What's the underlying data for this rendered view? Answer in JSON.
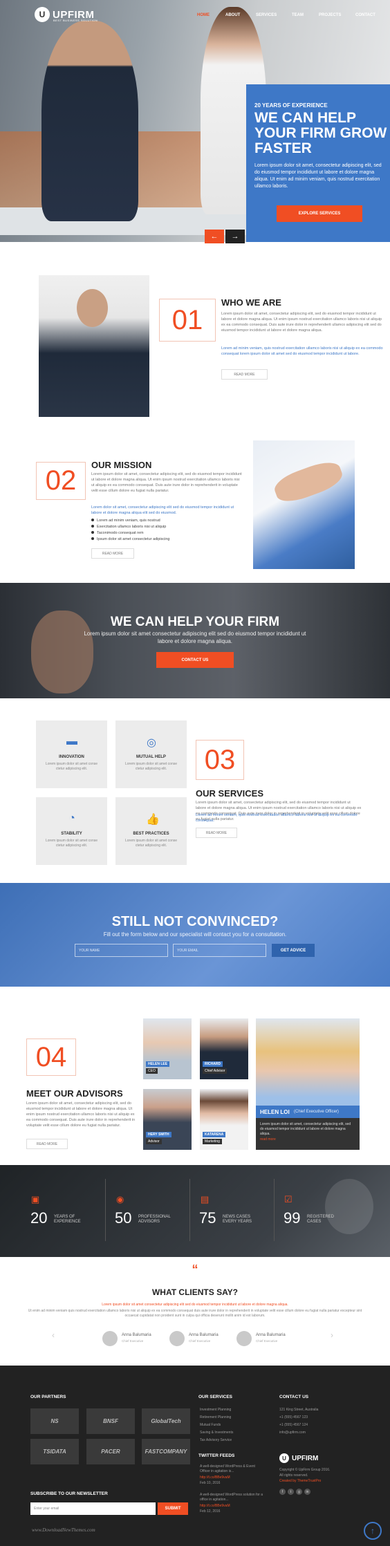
{
  "brand": {
    "name": "UPFIRM",
    "tagline": "BEST BUSINESS SOLUTION",
    "mark": "U"
  },
  "nav": [
    "HOME",
    "ABOUT",
    "SERVICES",
    "TEAM",
    "PROJECTS",
    "CONTACT"
  ],
  "hero": {
    "pre": "20 YEARS OF EXPERIENCE",
    "title": "WE CAN HELP YOUR FIRM GROW FASTER",
    "text": "Lorem ipsum dolor sit amet, consectetur adipiscing elit, sed do eiusmod tempor incididunt ut labore et dolore magna aliqua. Ut enim ad minim veniam, quis nostrud exercitation ullamco laboris.",
    "button": "EXPLORE SERVICES",
    "prev": "←",
    "next": "→"
  },
  "who": {
    "num": "01",
    "title": "WHO WE ARE",
    "p1": "Lorem ipsum dolor sit amet, consectetur adipiscing elit, sed do eiusmod tempor incididunt ut labore et dolore magna aliqua. Ut enim ipsum nostrud exercitation ullamco laboris nisi ut aliquip ex ea commodo consequat. Duis aute irure dolor in reprehenderit ullamco adipiscing elit sed do eiusmod tempor incididunt ut labore et dolore magna aliqua.",
    "p2": "Lorem ad minim veniam, quis nostrud exercitation ullamco laboris nisi ut aliquip ex ea commodo consequat lorem ipsum dolor sit amet sed do eiusmod tempor incididunt ut labore.",
    "more": "READ MORE"
  },
  "mission": {
    "num": "02",
    "title": "OUR MISSION",
    "p1": "Lorem ipsum dolor sit amet, consectetur adipiscing elit, sed do eiusmod tempor incididunt ut labore et dolore magna aliqua. Ut enim ipsum nostrud exercitation ullamco laboris nisi ut aliquip ex ea commodo consequat. Duis aute irure dolor in reprehenderit in voluptate velit esse cillum dolore eu fugiat nulla pariatur.",
    "p2": "Lorem dolor sit amet, consectetur adipiscing elit sed do eiusmod tempor incididunt ut labore et dolore magna aliqua elit sed do eiusmod.",
    "bullets": [
      "Lorem ad minim veniam, quis nostrud",
      "Exercitation ullamco laboris nisi ut aliquip",
      "Taconimodo consequat rem",
      "Ipsum dolor sit amet consectetur adipiscing"
    ],
    "more": "READ MORE"
  },
  "banner": {
    "title": "WE CAN HELP YOUR FIRM",
    "text": "Lorem ipsum dolor sit amet consectetur adipiscing elit sed do eiusmod tempor incididunt ut labore et dolore magna aliqua.",
    "button": "CONTACT US"
  },
  "services": {
    "num": "03",
    "title": "OUR SERVICES",
    "cards": [
      {
        "icon": "briefcase-icon",
        "glyph": "▬",
        "title": "INNOVATION",
        "desc": "Lorem ipsum dolor sit amet conse ctetur adipiscing elit."
      },
      {
        "icon": "lifebuoy-icon",
        "glyph": "◎",
        "title": "MUTUAL HELP",
        "desc": "Lorem ipsum dolor sit amet conse ctetur adipiscing elit."
      },
      {
        "icon": "gauge-icon",
        "glyph": "◔",
        "title": "STABILITY",
        "desc": "Lorem ipsum dolor sit amet conse ctetur adipiscing elit."
      },
      {
        "icon": "thumbs-up-icon",
        "glyph": "👍",
        "title": "BEST PRACTICES",
        "desc": "Lorem ipsum dolor sit amet conse ctetur adipiscing elit."
      }
    ],
    "p1": "Lorem ipsum dolor sit amet, consectetur adipiscing elit, sed do eiusmod tempor incididunt ut labore et dolore magna aliqua. Ut enim ipsum nostrud exercitation ullamco laboris nisi ut aliquip ex ea commodo consequat. Duis aute irure dolor in reprehenderit in voluptate velit esse cillum dolore eu fugiat nulla pariatur.",
    "p2": "Lorem ad minim veniam, quis nostrud exercitation ullamco laboris nisi ut aliquip ex ea commodo consequat.",
    "more": "READ MORE"
  },
  "convince": {
    "title": "STILL NOT CONVINCED?",
    "text": "Fill out the form below and our specialist will contact you for a consultation.",
    "name_ph": "YOUR NAME",
    "email_ph": "YOUR EMAIL",
    "button": "GET ADVICE"
  },
  "advisors": {
    "num": "04",
    "title": "MEET OUR ADVISORS",
    "p": "Lorem ipsum dolor sit amet, consectetur adipiscing elit, sed do eiusmod tempor incididunt ut labore et dolore magna aliqua. Ut enim ipsum nostrud exercitation ullamco laboris nisi ut aliquip ex ea commodo consequat. Duis aute irure dolor in reprehenderit in voluptate velit esse cillum dolore eu fugiat nulla pariatur.",
    "more": "READ MORE",
    "people": [
      {
        "name": "HELEN LEE",
        "role": "CEO"
      },
      {
        "name": "RICHARD",
        "role": "Chief Advisor"
      },
      {
        "name": "HERY SMITH",
        "role": "Advisor"
      },
      {
        "name": "KATARENA",
        "role": "Marketing"
      }
    ],
    "feature": {
      "name": "HELEN LOI",
      "role": "(Chief Executive Officer)",
      "text": "Lorem ipsum dolor sit amet, consectetur adipiscing elit, sed do eiusmod tempor incididunt ut labore et dolore magna aliqua.",
      "link": "read more"
    }
  },
  "stats": [
    {
      "num": "20",
      "label": "YEARS OF EXPERIENCE",
      "icon": "calendar-icon",
      "glyph": "▣"
    },
    {
      "num": "50",
      "label": "PROFESSIONAL ADVISORS",
      "icon": "user-icon",
      "glyph": "◉"
    },
    {
      "num": "75",
      "label": "NEWS CASES EVERY YEARS",
      "icon": "document-icon",
      "glyph": "▤"
    },
    {
      "num": "99",
      "label": "REGISTERED CASES",
      "icon": "checkbox-icon",
      "glyph": "☑"
    }
  ],
  "clients": {
    "quote": "“",
    "title": "WHAT CLIENTS SAY?",
    "p1": "Lorem ipsum dolor sit amet consectetur adipiscing elit sed do eiusmod tempor incididunt ut labore et dolore magna aliqua.",
    "p2": "Ut enim ad minim veniam quis nostrud exercitation ullamco laboris nisi ut aliquip ex ea commodo consequat duis aute irure dolor in reprehenderit in voluptate velit esse cillum dolore eu fugiat nulla pariatur excepteur sint occaecat cupidatat non proident sunt in culpa qui officia deserunt mollit anim id est laborum.",
    "people": [
      {
        "name": "Anna Balumaria",
        "role": "Chief Executive"
      },
      {
        "name": "Anna Balumaria",
        "role": "Chief Executive"
      },
      {
        "name": "Anna Balumaria",
        "role": "Chief Executive"
      }
    ],
    "prev": "‹",
    "next": "›"
  },
  "footer": {
    "partners_title": "OUR PARTNERS",
    "partners": [
      "NS",
      "BNSF",
      "GlobalTech",
      "TSIDATA",
      "PACER",
      "FASTCOMPANY"
    ],
    "services_title": "OUR SERVICES",
    "services": [
      "Investment Planning",
      "Retirement Planning",
      "Mutual Funds",
      "Saving & Investments",
      "Tax Advisory Service"
    ],
    "contact_title": "CONTACT US",
    "contact": [
      "121 King Street, Australia",
      "+1 (555) 4567 123",
      "+1 (555) 4567 124",
      "info@upfirm.com"
    ],
    "twitter_title": "TWITTER FEEDS",
    "tweets": [
      "A well-designed WordPress & Event Officer in agitation is...",
      "A well-designed WordPress solution for a office in agitation..."
    ],
    "tweet_links": [
      "http://t.co/BBe9vaM",
      "http://t.co/BBe9vaM"
    ],
    "tweet_dates": [
      "Feb 10, 2016",
      "Feb 12, 2016"
    ],
    "newsletter_title": "SUBSCRIBE TO OUR NEWSLETTER",
    "email_ph": "Enter your email",
    "submit": "SUBMIT",
    "copyright": "Copyright © UpFirm Group 2016.",
    "rights": "All rights reserved.",
    "credit": "Created by ThemeTrustPro",
    "social": [
      "f",
      "t",
      "g",
      "in"
    ],
    "watermark": "www.DownloadNewThemes.com",
    "top": "↑"
  },
  "colors": {
    "accent": "#f04e23",
    "blue": "#3e78c7",
    "dark": "#222222"
  }
}
